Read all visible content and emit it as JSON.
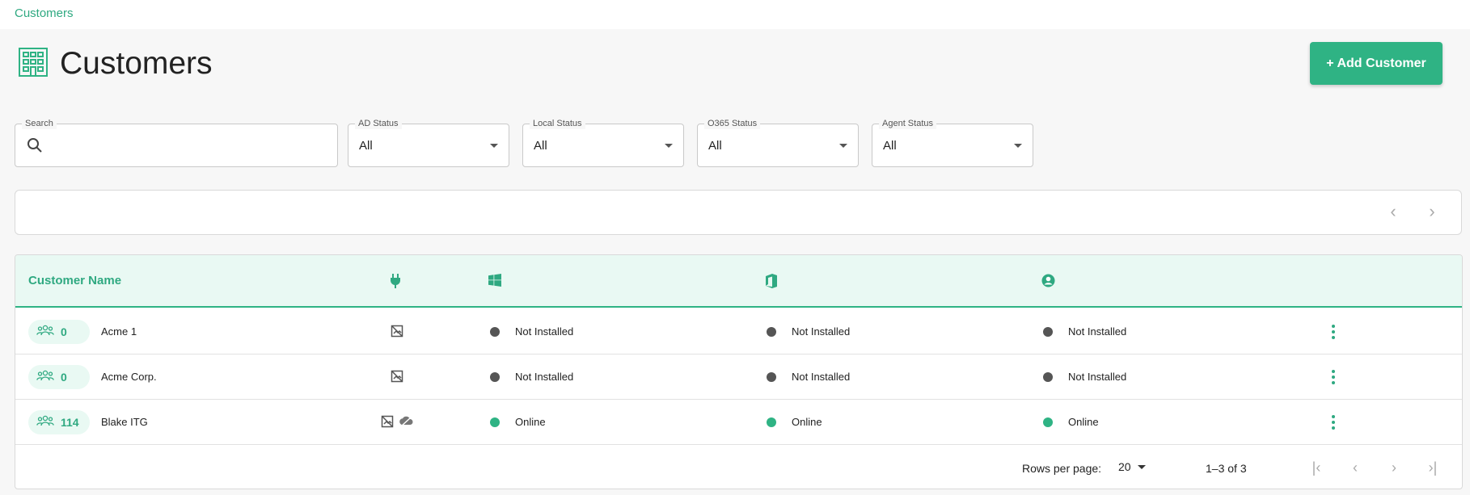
{
  "breadcrumb": "Customers",
  "page": {
    "title": "Customers",
    "add_button": "+ Add Customer"
  },
  "filters": {
    "search": {
      "label": "Search",
      "value": ""
    },
    "ad_status": {
      "label": "AD Status",
      "value": "All"
    },
    "local_status": {
      "label": "Local Status",
      "value": "All"
    },
    "o365_status": {
      "label": "O365 Status",
      "value": "All"
    },
    "agent_status": {
      "label": "Agent Status",
      "value": "All"
    }
  },
  "table": {
    "header": {
      "name": "Customer Name",
      "icons": [
        "plug-icon",
        "windows-icon",
        "office-icon",
        "user-circle-icon"
      ]
    },
    "rows": [
      {
        "count": "0",
        "name": "Acme 1",
        "connectors": [
          "no-image-icon"
        ],
        "ad": "Not Installed",
        "o365": "Not Installed",
        "agent": "Not Installed",
        "ad_color": "#555555",
        "o365_color": "#555555",
        "agent_color": "#555555"
      },
      {
        "count": "0",
        "name": "Acme Corp.",
        "connectors": [
          "no-image-icon"
        ],
        "ad": "Not Installed",
        "o365": "Not Installed",
        "agent": "Not Installed",
        "ad_color": "#555555",
        "o365_color": "#555555",
        "agent_color": "#555555"
      },
      {
        "count": "114",
        "name": "Blake ITG",
        "connectors": [
          "no-image-icon",
          "cloud-sync-icon"
        ],
        "ad": "Online",
        "o365": "Online",
        "agent": "Online",
        "ad_color": "#2fb384",
        "o365_color": "#2fb384",
        "agent_color": "#2fb384"
      }
    ]
  },
  "pagination": {
    "rows_per_page_label": "Rows per page:",
    "rows_per_page": "20",
    "range": "1–3 of 3"
  },
  "colors": {
    "accent": "#2fb384",
    "accent_text": "#2fa981",
    "header_bg": "#e9f9f3",
    "inactive": "#555555"
  }
}
